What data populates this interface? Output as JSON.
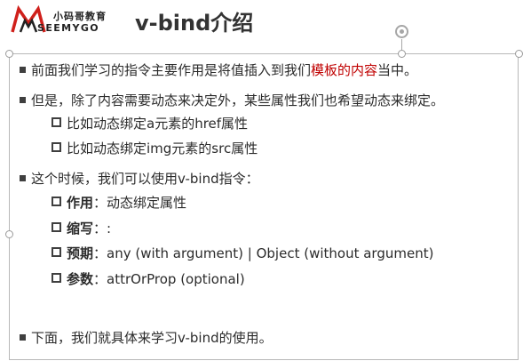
{
  "header": {
    "logo_cn": "小码哥教育",
    "logo_en": "SEEMYGO",
    "title": "v-bind介绍"
  },
  "lines": {
    "p1": {
      "pre": "前面我们学习的指令主要作用是将值插入到我们",
      "highlight": "模板的内容",
      "post": "当中。"
    },
    "p2": {
      "text": "但是，除了内容需要动态来决定外，某些属性我们也希望动态来绑定。"
    },
    "p2a": {
      "text": "比如动态绑定a元素的href属性"
    },
    "p2b": {
      "text": "比如动态绑定img元素的src属性"
    },
    "p3": {
      "text": "这个时候，我们可以使用v-bind指令："
    },
    "p3a": {
      "label": "作用",
      "value": "：动态绑定属性"
    },
    "p3b": {
      "label": "缩写",
      "value": "：:"
    },
    "p3c": {
      "label": "预期",
      "value": "：any (with argument) | Object (without argument)"
    },
    "p3d": {
      "label": "参数",
      "value": "：attrOrProp (optional)"
    },
    "p4": {
      "text": "下面，我们就具体来学习v-bind的使用。"
    }
  },
  "colors": {
    "highlight": "#c00000",
    "logo_red": "#d0201b",
    "text": "#2b2b2b"
  }
}
